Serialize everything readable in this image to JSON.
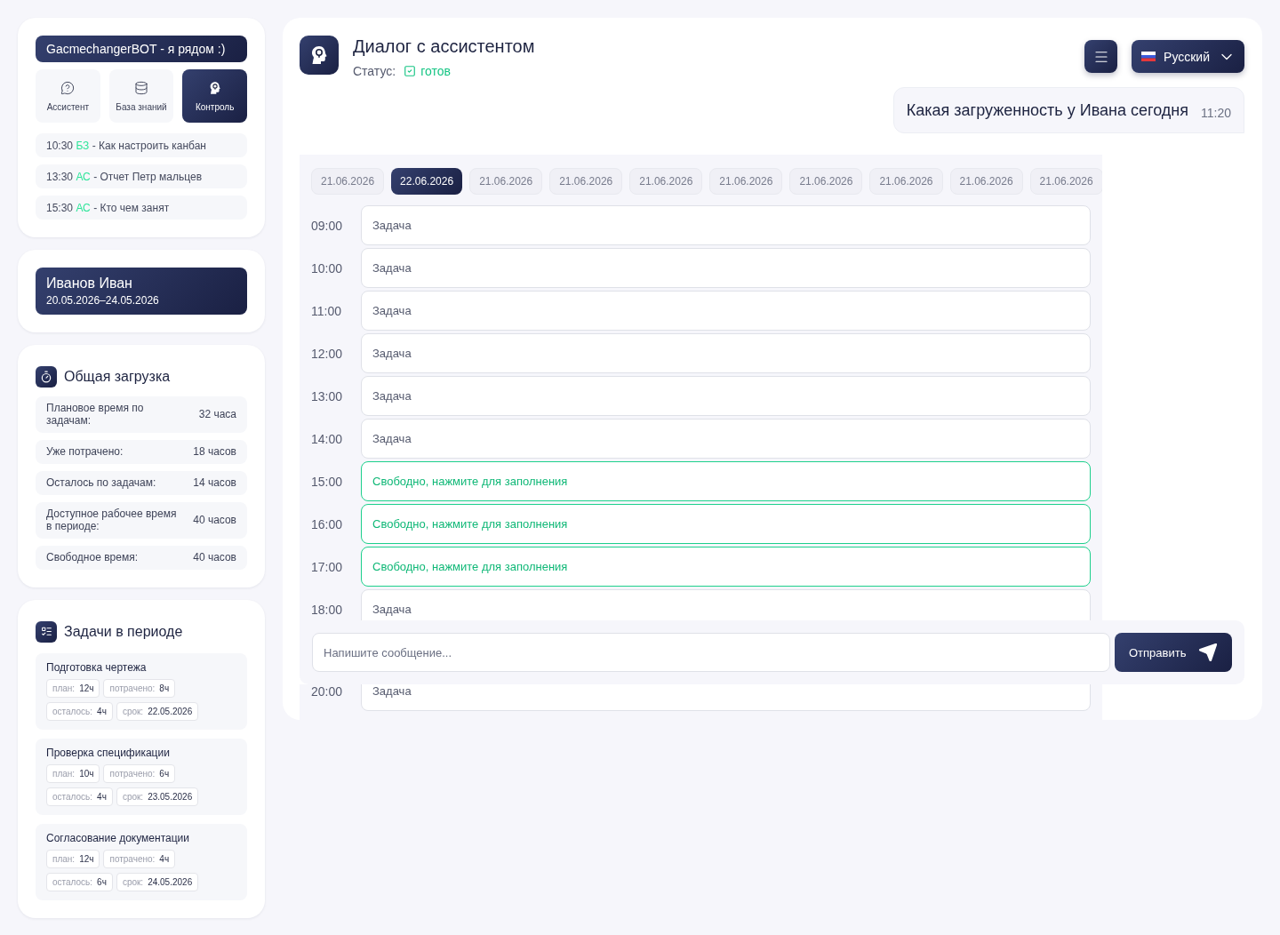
{
  "sidebar": {
    "bot_title": "GacmechangerBOT - я рядом :)",
    "modes": [
      {
        "label": "Ассистент",
        "selected": false
      },
      {
        "label": "База знаний",
        "selected": false
      },
      {
        "label": "Контроль",
        "selected": true
      }
    ],
    "history": [
      {
        "time": "10:30",
        "tag": "БЗ",
        "text": "- Как настроить канбан"
      },
      {
        "time": "13:30",
        "tag": "АС",
        "text": "- Отчет Петр мальцев"
      },
      {
        "time": "15:30",
        "tag": "АС",
        "text": "- Кто чем занят"
      }
    ]
  },
  "employee": {
    "name": "Иванов Иван",
    "period": "20.05.2026–24.05.2026"
  },
  "workload": {
    "title": "Общая загрузка",
    "rows": [
      {
        "label": "Плановое время по задачам:",
        "value": "32 часа"
      },
      {
        "label": "Уже потрачено:",
        "value": "18 часов"
      },
      {
        "label": "Осталось по задачам:",
        "value": "14 часов"
      },
      {
        "label": "Доступное рабочее время в периоде:",
        "value": "40 часов"
      },
      {
        "label": "Свободное время:",
        "value": "40 часов"
      }
    ]
  },
  "tasks": {
    "title": "Задачи в периоде",
    "items": [
      {
        "name": "Подготовка чертежа",
        "stats": [
          {
            "label": "план:",
            "value": "12ч"
          },
          {
            "label": "потрачено:",
            "value": "8ч"
          },
          {
            "label": "осталось:",
            "value": "4ч"
          },
          {
            "label": "срок:",
            "value": "22.05.2026"
          }
        ]
      },
      {
        "name": "Проверка спецификации",
        "stats": [
          {
            "label": "план:",
            "value": "10ч"
          },
          {
            "label": "потрачено:",
            "value": "6ч"
          },
          {
            "label": "осталось:",
            "value": "4ч"
          },
          {
            "label": "срок:",
            "value": "23.05.2026"
          }
        ]
      },
      {
        "name": "Согласование документации",
        "stats": [
          {
            "label": "план:",
            "value": "12ч"
          },
          {
            "label": "потрачено:",
            "value": "4ч"
          },
          {
            "label": "осталось:",
            "value": "6ч"
          },
          {
            "label": "срок:",
            "value": "24.05.2026"
          }
        ]
      }
    ]
  },
  "chat": {
    "title": "Диалог с ассистентом",
    "status_label": "Статус:",
    "status": "готов",
    "language": "Русский",
    "message": {
      "text": "Какая загруженность у Ивана сегодня",
      "time": "11:20"
    },
    "dates": [
      {
        "label": "21.06.2026",
        "selected": false
      },
      {
        "label": "22.06.2026",
        "selected": true
      },
      {
        "label": "21.06.2026",
        "selected": false
      },
      {
        "label": "21.06.2026",
        "selected": false
      },
      {
        "label": "21.06.2026",
        "selected": false
      },
      {
        "label": "21.06.2026",
        "selected": false
      },
      {
        "label": "21.06.2026",
        "selected": false
      },
      {
        "label": "21.06.2026",
        "selected": false
      },
      {
        "label": "21.06.2026",
        "selected": false
      },
      {
        "label": "21.06.2026",
        "selected": false
      }
    ],
    "slots": [
      {
        "time": "09:00",
        "text": "Задача",
        "kind": "task"
      },
      {
        "time": "10:00",
        "text": "Задача",
        "kind": "task"
      },
      {
        "time": "11:00",
        "text": "Задача",
        "kind": "task"
      },
      {
        "time": "12:00",
        "text": "Задача",
        "kind": "task"
      },
      {
        "time": "13:00",
        "text": "Задача",
        "kind": "task"
      },
      {
        "time": "14:00",
        "text": "Задача",
        "kind": "task"
      },
      {
        "time": "15:00",
        "text": "Свободно, нажмите для заполнения",
        "kind": "free"
      },
      {
        "time": "16:00",
        "text": "Свободно, нажмите для заполнения",
        "kind": "free"
      },
      {
        "time": "17:00",
        "text": "Свободно, нажмите для заполнения",
        "kind": "free"
      },
      {
        "time": "18:00",
        "text": "Задача",
        "kind": "task"
      }
    ],
    "slots_below": [
      {
        "time": "20:00",
        "text": "Задача"
      }
    ],
    "input": {
      "placeholder": "Напишите сообщение..."
    },
    "send": "Отправить"
  }
}
